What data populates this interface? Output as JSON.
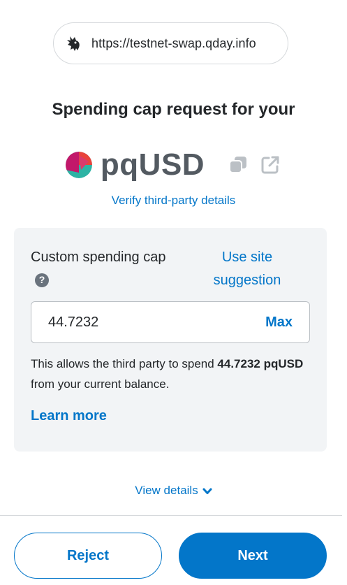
{
  "origin": {
    "url": "https://testnet-swap.qday.info",
    "icon": "unicorn-icon"
  },
  "title": "Spending cap request for your",
  "token": {
    "symbol": "pqUSD",
    "copy_icon": "copy-icon",
    "open_icon": "external-link-icon"
  },
  "verify_link": "Verify third-party details",
  "card": {
    "label": "Custom spending cap",
    "help_icon": "?",
    "use_site_suggestion": "Use site suggestion",
    "amount_value": "44.7232",
    "max_label": "Max",
    "desc_prefix": "This allows the third party to spend ",
    "desc_amount": "44.7232 pqUSD",
    "desc_suffix": " from your current balance.",
    "learn_more": "Learn more"
  },
  "view_details": "View details",
  "footer": {
    "reject_label": "Reject",
    "next_label": "Next"
  },
  "colors": {
    "primary": "#0376c9",
    "card_bg": "#f2f4f6",
    "text": "#24272a"
  }
}
